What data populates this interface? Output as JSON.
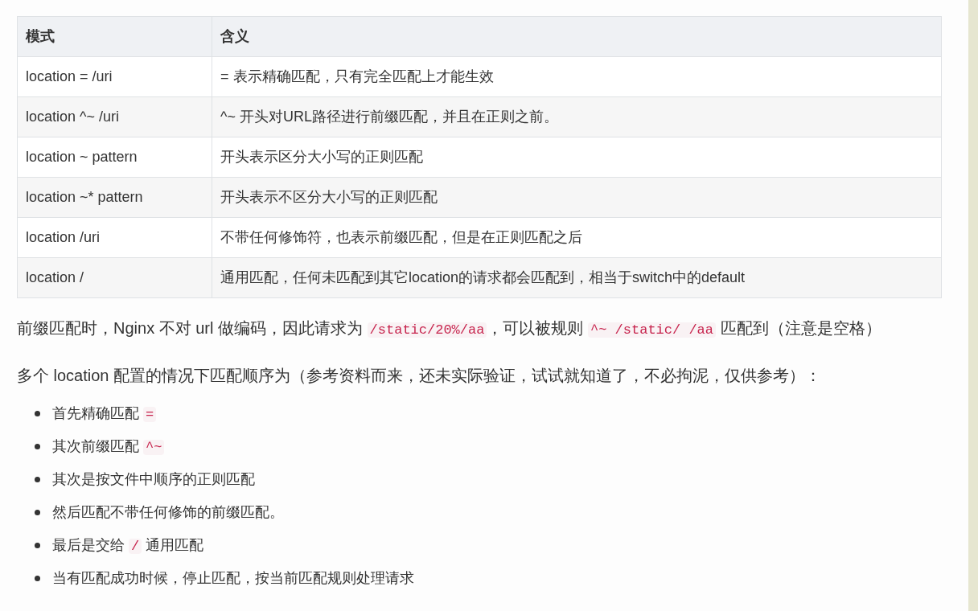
{
  "table": {
    "columns": [
      "模式",
      "含义"
    ],
    "rows": [
      [
        "location = /uri",
        "= 表示精确匹配，只有完全匹配上才能生效"
      ],
      [
        "location ^~ /uri",
        "^~ 开头对URL路径进行前缀匹配，并且在正则之前。"
      ],
      [
        "location ~ pattern",
        "开头表示区分大小写的正则匹配"
      ],
      [
        "location ~* pattern",
        "开头表示不区分大小写的正则匹配"
      ],
      [
        "location /uri",
        "不带任何修饰符，也表示前缀匹配，但是在正则匹配之后"
      ],
      [
        "location /",
        "通用匹配，任何未匹配到其它location的请求都会匹配到，相当于switch中的default"
      ]
    ]
  },
  "paragraphs": [
    [
      {
        "kind": "text",
        "text": "前缀匹配时，Nginx 不对 url 做编码，因此请求为 "
      },
      {
        "kind": "code",
        "text": "/static/20%/aa"
      },
      {
        "kind": "text",
        "text": "，可以被规则 "
      },
      {
        "kind": "code",
        "text": "^~ /static/ /aa"
      },
      {
        "kind": "text",
        "text": " 匹配到（注意是空格）"
      }
    ],
    [
      {
        "kind": "text",
        "text": "多个 location 配置的情况下匹配顺序为（参考资料而来，还未实际验证，试试就知道了，不必拘泥，仅供参考）："
      }
    ]
  ],
  "list": [
    [
      {
        "kind": "text",
        "text": "首先精确匹配 "
      },
      {
        "kind": "code",
        "text": "="
      }
    ],
    [
      {
        "kind": "text",
        "text": "其次前缀匹配 "
      },
      {
        "kind": "code",
        "text": "^~"
      }
    ],
    [
      {
        "kind": "text",
        "text": "其次是按文件中顺序的正则匹配"
      }
    ],
    [
      {
        "kind": "text",
        "text": "然后匹配不带任何修饰的前缀匹配。"
      }
    ],
    [
      {
        "kind": "text",
        "text": "最后是交给 "
      },
      {
        "kind": "code",
        "text": "/"
      },
      {
        "kind": "text",
        "text": " 通用匹配"
      }
    ],
    [
      {
        "kind": "text",
        "text": "当有匹配成功时候，停止匹配，按当前匹配规则处理请求"
      }
    ]
  ]
}
